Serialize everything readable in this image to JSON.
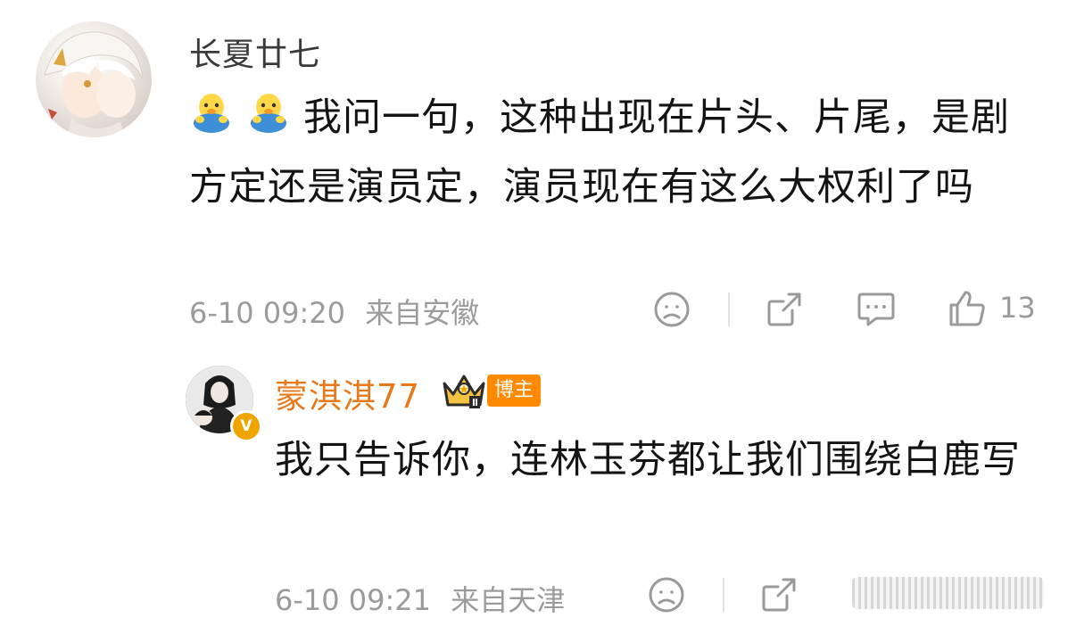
{
  "comments": [
    {
      "username": "长夏廿七",
      "text": "我问一句，这种出现在片头、片尾，是剧方定还是演员定，演员现在有这么大权利了吗",
      "emojis": [
        "chick-emoji",
        "chick-emoji"
      ],
      "time": "6-10 09:20",
      "location": "来自安徽",
      "like_count": "13"
    },
    {
      "username": "蒙淇淇77",
      "badge": "博主",
      "text": "我只告诉你，连林玉芬都让我们围绕白鹿写",
      "time": "6-10 09:21",
      "location": "来自天津"
    }
  ],
  "icons": {
    "dislike": "sad-face-icon",
    "share": "share-icon",
    "comment": "comment-icon",
    "like": "thumbs-up-icon",
    "crown": "crown-icon",
    "verified": "v-badge-icon"
  },
  "colors": {
    "reply_username": "#e8791a",
    "badge_bg": "#ff8a00",
    "meta_text": "#9b9b9b"
  }
}
